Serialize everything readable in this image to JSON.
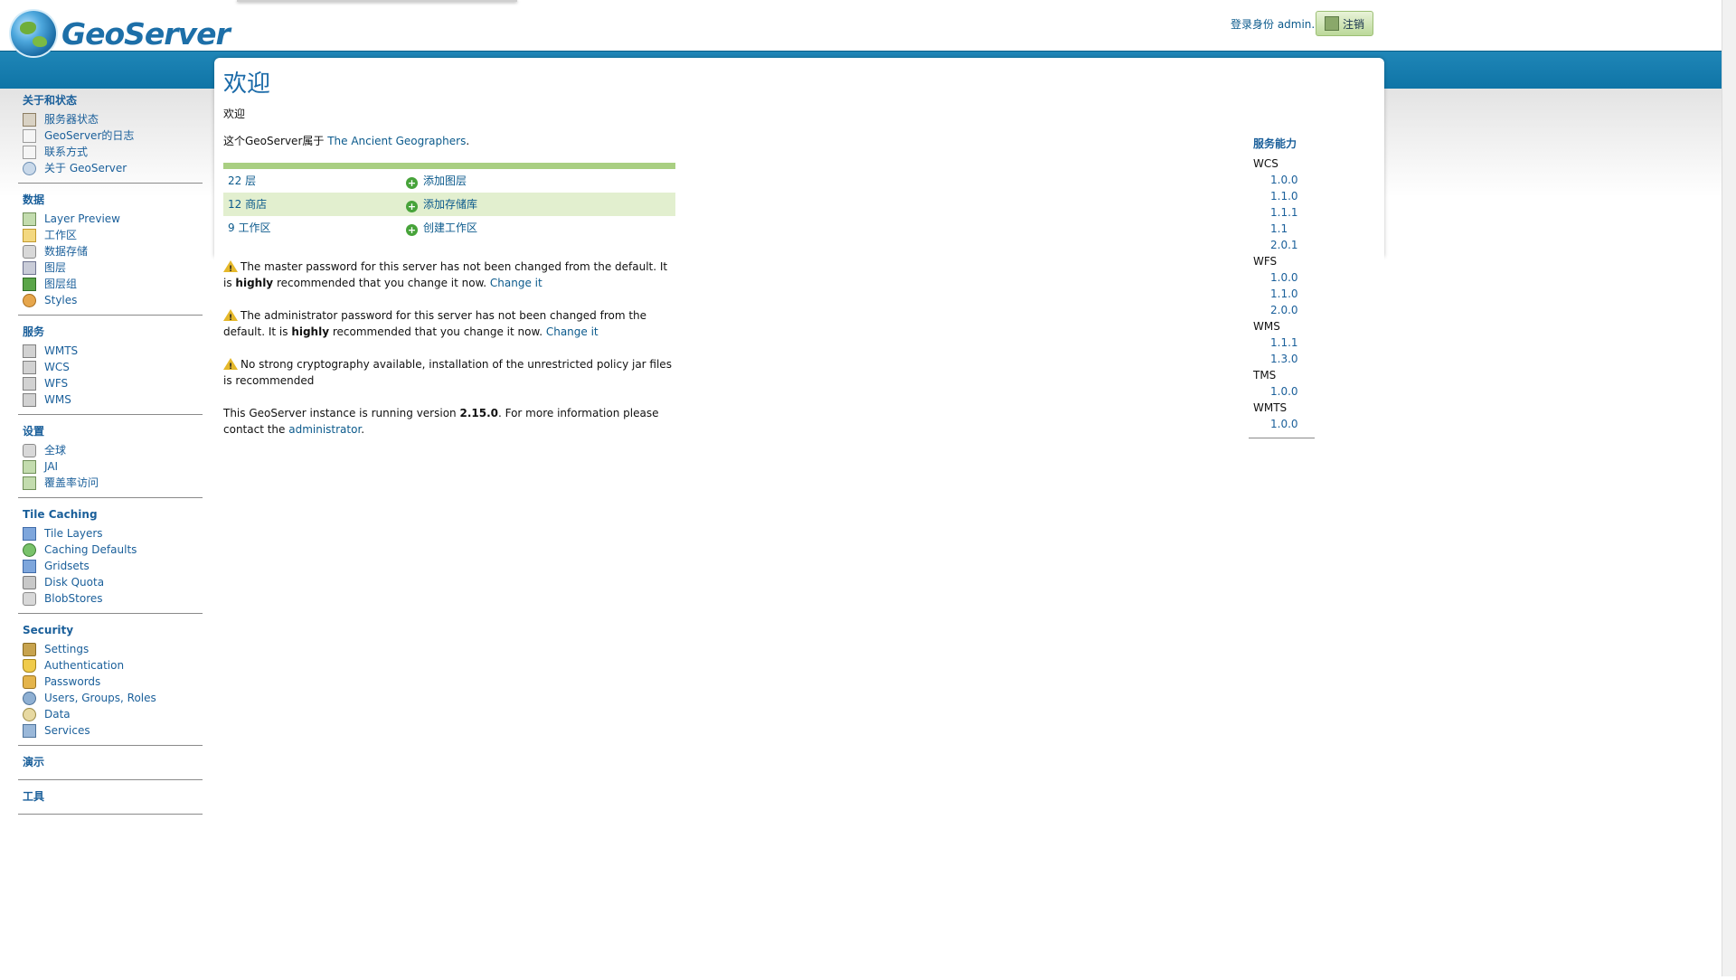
{
  "header": {
    "logo_text": "GeoServer",
    "login_text": "登录身份 admin.",
    "logout_label": "注销"
  },
  "sidebar": {
    "sections": [
      {
        "title": "关于和状态",
        "items": [
          {
            "label": "服务器状态",
            "icon": "server-status-icon"
          },
          {
            "label": "GeoServer的日志",
            "icon": "log-icon"
          },
          {
            "label": "联系方式",
            "icon": "contact-icon"
          },
          {
            "label": "关于 GeoServer",
            "icon": "about-icon"
          }
        ]
      },
      {
        "title": "数据",
        "items": [
          {
            "label": "Layer Preview",
            "icon": "layer-preview-icon"
          },
          {
            "label": "工作区",
            "icon": "workspace-folder-icon"
          },
          {
            "label": "数据存储",
            "icon": "datastore-icon"
          },
          {
            "label": "图层",
            "icon": "layer-icon"
          },
          {
            "label": "图层组",
            "icon": "layer-group-icon"
          },
          {
            "label": "Styles",
            "icon": "styles-icon"
          }
        ]
      },
      {
        "title": "服务",
        "items": [
          {
            "label": "WMTS",
            "icon": "service-icon"
          },
          {
            "label": "WCS",
            "icon": "service-icon"
          },
          {
            "label": "WFS",
            "icon": "service-icon"
          },
          {
            "label": "WMS",
            "icon": "service-icon"
          }
        ]
      },
      {
        "title": "设置",
        "items": [
          {
            "label": "全球",
            "icon": "global-icon"
          },
          {
            "label": "JAI",
            "icon": "jai-icon"
          },
          {
            "label": "覆盖率访问",
            "icon": "coverage-icon"
          }
        ]
      },
      {
        "title": "Tile Caching",
        "items": [
          {
            "label": "Tile Layers",
            "icon": "tile-layers-icon"
          },
          {
            "label": "Caching Defaults",
            "icon": "caching-globe-icon"
          },
          {
            "label": "Gridsets",
            "icon": "gridsets-icon"
          },
          {
            "label": "Disk Quota",
            "icon": "disk-icon"
          },
          {
            "label": "BlobStores",
            "icon": "blobstore-icon"
          }
        ]
      },
      {
        "title": "Security",
        "items": [
          {
            "label": "Settings",
            "icon": "key-icon"
          },
          {
            "label": "Authentication",
            "icon": "shield-icon"
          },
          {
            "label": "Passwords",
            "icon": "lock-icon"
          },
          {
            "label": "Users, Groups, Roles",
            "icon": "users-icon"
          },
          {
            "label": "Data",
            "icon": "data-icon"
          },
          {
            "label": "Services",
            "icon": "services-pen-icon"
          }
        ]
      },
      {
        "title": "演示",
        "items": []
      },
      {
        "title": "工具",
        "items": []
      }
    ]
  },
  "main": {
    "title": "欢迎",
    "subtitle": "欢迎",
    "owner_prefix": "这个GeoServer属于",
    "owner_link": "The Ancient Geographers",
    "owner_suffix": ".",
    "stats": [
      {
        "count": "22 层",
        "action": "添加图层"
      },
      {
        "count": "12 商店",
        "action": "添加存储库"
      },
      {
        "count": "9 工作区",
        "action": "创建工作区"
      }
    ],
    "warnings": {
      "master_a": "The master password for this server has not been changed from the default. It is ",
      "master_b": "highly",
      "master_c": " recommended that you change it now. ",
      "admin_a": "The administrator password for this server has not been changed from the default. It is ",
      "admin_b": "highly",
      "admin_c": " recommended that you change it now. ",
      "change_link": "Change it",
      "crypto": "No strong cryptography available, installation of the unrestricted policy jar files is recommended"
    },
    "version": {
      "prefix": "This GeoServer instance is running version ",
      "number": "2.15.0",
      "middle": ". For more information please contact the ",
      "link": "administrator",
      "suffix": "."
    }
  },
  "capabilities": {
    "title": "服务能力",
    "services": [
      {
        "name": "WCS",
        "versions": [
          "1.0.0",
          "1.1.0",
          "1.1.1",
          "1.1",
          "2.0.1"
        ]
      },
      {
        "name": "WFS",
        "versions": [
          "1.0.0",
          "1.1.0",
          "2.0.0"
        ]
      },
      {
        "name": "WMS",
        "versions": [
          "1.1.1",
          "1.3.0"
        ]
      },
      {
        "name": "TMS",
        "versions": [
          "1.0.0"
        ]
      },
      {
        "name": "WMTS",
        "versions": [
          "1.0.0"
        ]
      }
    ]
  }
}
